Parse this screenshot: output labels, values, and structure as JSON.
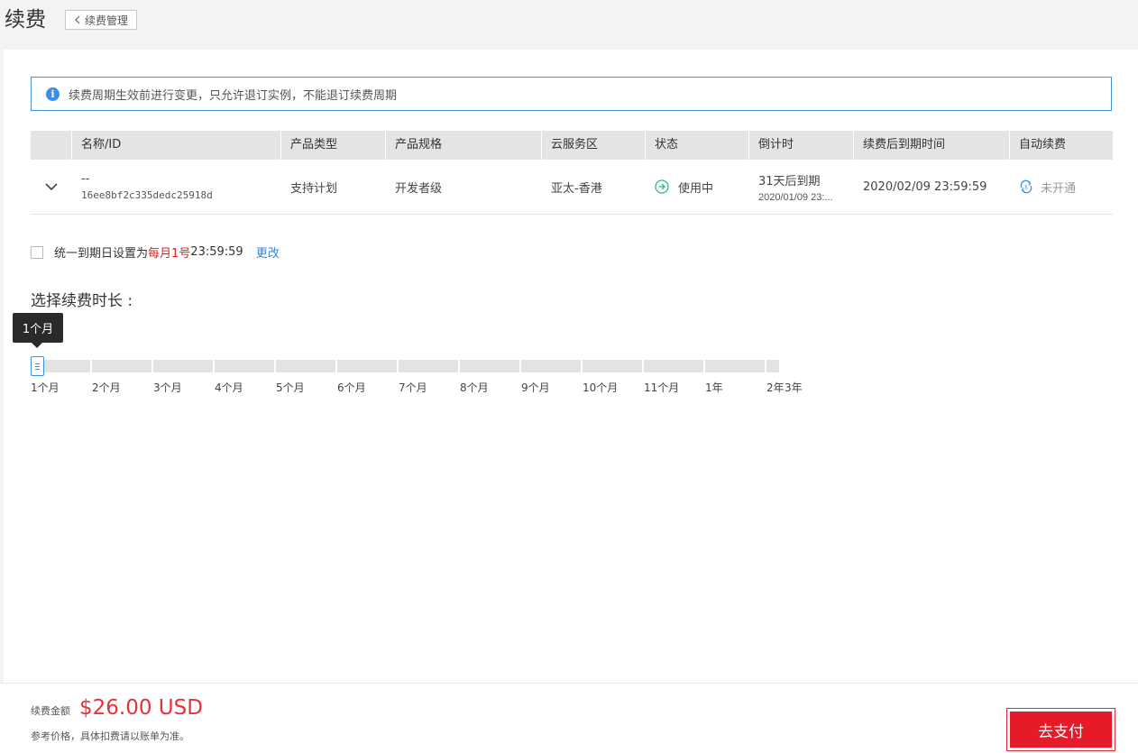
{
  "page": {
    "title": "续费",
    "back_label": "续费管理"
  },
  "notice": {
    "text": "续费周期生效前进行变更，只允许退订实例，不能退订续费周期"
  },
  "table": {
    "headers": [
      "名称/ID",
      "产品类型",
      "产品规格",
      "云服务区",
      "状态",
      "倒计时",
      "续费后到期时间",
      "自动续费"
    ],
    "rows": [
      {
        "name": "--",
        "id": "16ee8bf2c335dedc25918d",
        "product_type": "支持计划",
        "spec": "开发者级",
        "region": "亚太-香港",
        "status": "使用中",
        "countdown": "31天后到期",
        "countdown_date": "2020/01/09 23:...",
        "expire_after": "2020/02/09 23:59:59",
        "auto_renew": "未开通"
      }
    ]
  },
  "unify": {
    "prefix": "统一到期日设置为",
    "highlight": "每月1号",
    "time": "23:59:59",
    "change_label": "更改"
  },
  "duration": {
    "title": "选择续费时长 :",
    "selected": "1个月",
    "selected_index": 0,
    "options": [
      "1个月",
      "2个月",
      "3个月",
      "4个月",
      "5个月",
      "6个月",
      "7个月",
      "8个月",
      "9个月",
      "10个月",
      "11个月",
      "1年",
      "2年",
      "3年"
    ]
  },
  "footer": {
    "fee_label": "续费金额",
    "fee_amount": "$26.00 USD",
    "note": "参考价格，具体扣费请以账单为准。",
    "pay_label": "去支付"
  },
  "colors": {
    "accent": "#3a8ee6",
    "danger": "#e51b2a",
    "price": "#e8303a",
    "header_bg": "#e2e4e6"
  }
}
